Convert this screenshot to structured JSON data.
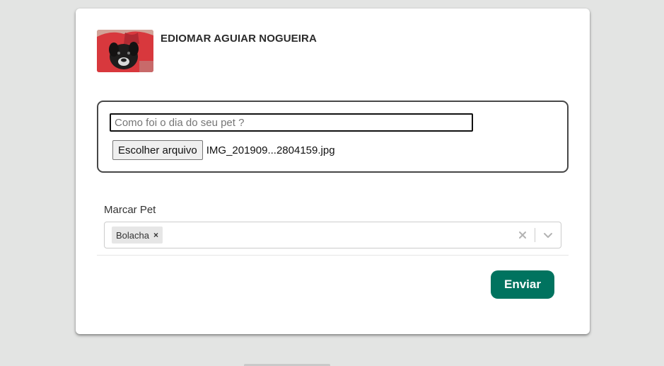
{
  "user": {
    "name": "EDIOMAR AGUIAR NOGUEIRA",
    "avatar": "pet-photo"
  },
  "post": {
    "caption_placeholder": "Como foi o dia do seu pet ?",
    "caption_value": "",
    "file_button_label": "Escolher arquivo",
    "file_name": "IMG_201909...2804159.jpg"
  },
  "tag_pet": {
    "label": "Marcar Pet",
    "selected": [
      {
        "label": "Bolacha",
        "remove_icon": "×"
      }
    ],
    "clear_icon": "close-icon",
    "dropdown_icon": "chevron-down-icon"
  },
  "actions": {
    "submit_label": "Enviar"
  },
  "colors": {
    "accent": "#00735f",
    "background": "#e3e4e3"
  }
}
